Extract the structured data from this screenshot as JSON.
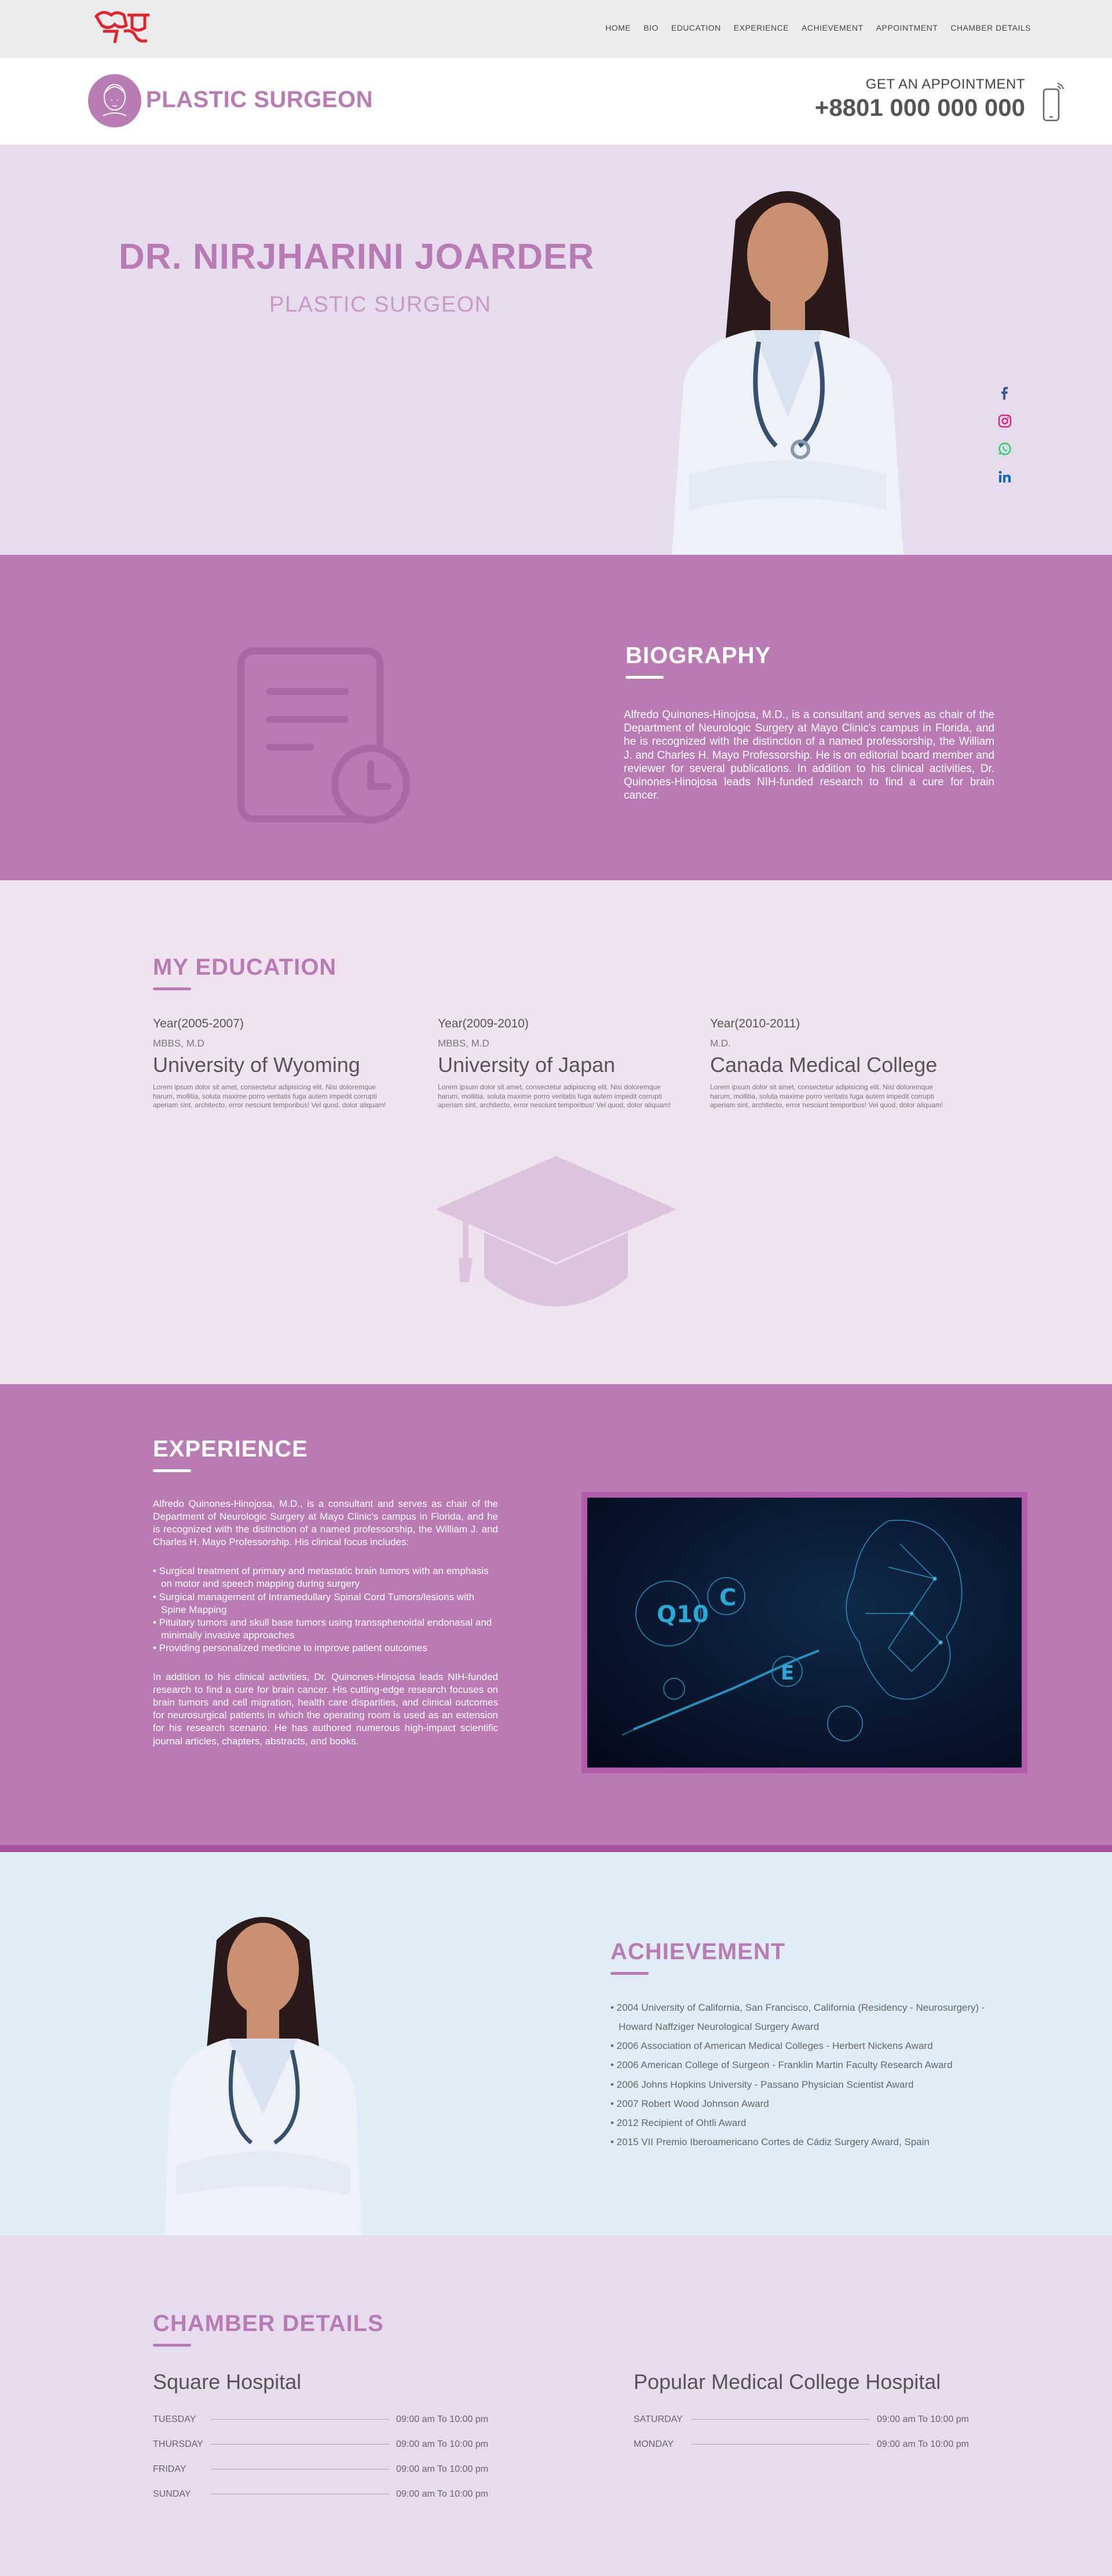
{
  "nav": [
    "HOME",
    "BIO",
    "EDUCATION",
    "EXPERIENCE",
    "ACHIEVEMENT",
    "APPOINTMENT",
    "CHAMBER DETAILS"
  ],
  "header": {
    "brand": "PLASTIC SURGEON",
    "appointment_label": "GET AN APPOINTMENT",
    "phone": "+8801 000 000 000"
  },
  "hero": {
    "name": "DR. NIRJHARINI JOARDER",
    "title": "PLASTIC SURGEON"
  },
  "social": [
    "facebook-icon",
    "instagram-icon",
    "whatsapp-icon",
    "linkedin-icon"
  ],
  "biography": {
    "title": "BIOGRAPHY",
    "text": "Alfredo Quinones-Hinojosa, M.D., is a consultant and serves as chair of the Department of Neurologic Surgery at Mayo Clinic's campus in Florida, and he is recognized with the distinction of a named professorship, the William J. and Charles H. Mayo Professorship. He is on editorial board member and reviewer for several publications. In addition to his clinical activities, Dr. Quinones-Hinojosa leads NIH-funded research to find a cure for brain cancer."
  },
  "education": {
    "title": "MY EDUCATION",
    "items": [
      {
        "year": "Year(2005-2007)",
        "degree": "MBBS, M.D",
        "university": "University of Wyoming",
        "desc": "Lorem ipsum dolor sit amet, consectetur adipisicing elit. Nisi doloremque harum, mollitia, soluta maxime porro veritatis fuga autem impedit corrupti aperiam sint, architecto, error nesciunt temporibus! Vel quod, dolor aliquam!"
      },
      {
        "year": "Year(2009-2010)",
        "degree": "MBBS, M.D",
        "university": "University of Japan",
        "desc": "Lorem ipsum dolor sit amet, consectetur adipisicing elit. Nisi doloremque harum, mollitia, soluta maxime porro veritatis fuga autem impedit corrupti aperiam sint, architecto, error nesciunt temporibus! Vel quod, dolor aliquam!"
      },
      {
        "year": "Year(2010-2011)",
        "degree": "M.D.",
        "university": "Canada Medical College",
        "desc": "Lorem ipsum dolor sit amet, consectetur adipisicing elit. Nisi doloremque harum, mollitia, soluta maxime porro veritatis fuga autem impedit corrupti aperiam sint, architecto, error nesciunt temporibus! Vel quod, dolor aliquam!"
      }
    ]
  },
  "experience": {
    "title": "EXPERIENCE",
    "intro": "Alfredo Quinones-Hinojosa, M.D., is a consultant and serves as chair of the Department of Neurologic Surgery at Mayo Clinic's campus in Florida, and he is recognized with the distinction of a named professorship, the William J. and Charles H. Mayo Professorship. His clinical focus includes:",
    "bullets": [
      "• Surgical treatment of primary and metastatic brain tumors with an emphasis on motor and speech mapping during surgery",
      "• Surgical management of Intramedullary Spinal Cord Tumors/lesions with Spine Mapping",
      "• Pituitary tumors and skull base tumors using transsphenoidal endonasal and minimally invasive approaches",
      "• Providing personalized medicine to improve patient outcomes"
    ],
    "outro": "In addition to his clinical activities, Dr. Quinones-Hinojosa leads NIH-funded research to find a cure for brain cancer. His cutting-edge research focuses on brain tumors and cell migration, health care disparities, and clinical outcomes for neurosurgical patients in which the operating room is used as an extension for his research scenario. He has authored numerous high-impact scientific journal articles, chapters, abstracts, and books."
  },
  "achievement": {
    "title": "ACHIEVEMENT",
    "items": [
      "• 2004 University of California, San Francisco, California (Residency - Neurosurgery) - Howard Naffziger Neurological Surgery Award",
      "• 2006 Association of American Medical Colleges - Herbert Nickens Award",
      "• 2006 American College of Surgeon - Franklin Martin Faculty Research Award",
      "• 2006 Johns Hopkins University - Passano Physician Scientist Award",
      "• 2007 Robert Wood Johnson Award",
      "• 2012 Recipient of Ohtli Award",
      "• 2015 VII Premio Iberoamericano Cortes de Cádiz Surgery Award, Spain"
    ]
  },
  "chamber": {
    "title": "CHAMBER DETAILS",
    "hospitals": [
      {
        "name": "Square Hospital",
        "schedule": [
          {
            "day": "TUESDAY",
            "time": "09:00 am To 10:00 pm"
          },
          {
            "day": "THURSDAY",
            "time": "09:00 am To 10:00 pm"
          },
          {
            "day": "FRIDAY",
            "time": "09:00 am To 10:00 pm"
          },
          {
            "day": "SUNDAY",
            "time": "09:00 am To 10:00 pm"
          }
        ]
      },
      {
        "name": "Popular Medical College Hospital",
        "schedule": [
          {
            "day": "SATURDAY",
            "time": "09:00 am To 10:00 pm"
          },
          {
            "day": "MONDAY",
            "time": "09:00 am To 10:00 pm"
          }
        ]
      }
    ]
  },
  "colors": {
    "accent": "#b87bb4",
    "hero_bg": "#e6dcee",
    "edu_bg": "#f0e3f0",
    "ach_bg": "#e0edf6"
  }
}
